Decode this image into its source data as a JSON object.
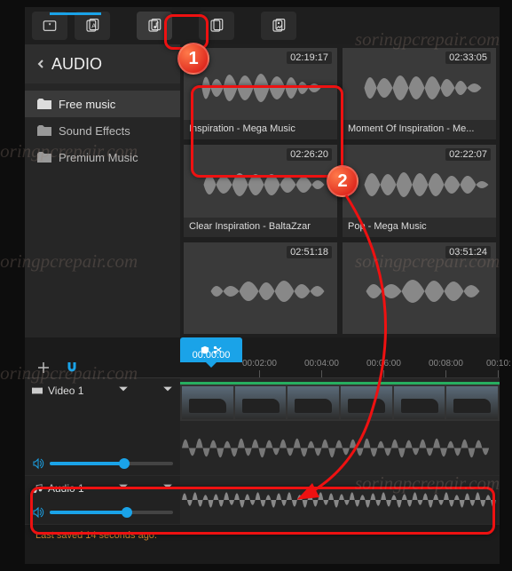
{
  "topbar": {
    "tabs": [
      "favorites",
      "text",
      "audio",
      "media",
      "image"
    ],
    "active_index": 2
  },
  "sidebar": {
    "title": "AUDIO",
    "categories": [
      {
        "label": "Free music",
        "selected": true
      },
      {
        "label": "Sound Effects",
        "selected": false
      },
      {
        "label": "Premium Music",
        "selected": false
      }
    ]
  },
  "clips": [
    {
      "duration": "02:19:17",
      "label": "Inspiration - Mega Music"
    },
    {
      "duration": "02:33:05",
      "label": "Moment Of Inspiration - Me..."
    },
    {
      "duration": "02:26:20",
      "label": "Clear Inspiration - BaltaZzar"
    },
    {
      "duration": "02:22:07",
      "label": "Pop - Mega Music"
    },
    {
      "duration": "02:51:18",
      "label": ""
    },
    {
      "duration": "03:51:24",
      "label": ""
    }
  ],
  "timeline": {
    "playhead": "00:00:00",
    "ticks": [
      "00:02:00",
      "00:04:00",
      "00:06:00",
      "00:08:00",
      "00:10:"
    ],
    "tracks": [
      {
        "type": "video",
        "name": "Video 1"
      },
      {
        "type": "audio",
        "name": "Audio 1"
      }
    ]
  },
  "status": "Last saved 14 seconds ago.",
  "annotations": {
    "step1": "1",
    "step2": "2"
  },
  "colors": {
    "accent": "#1aa3e8",
    "highlight": "#e11",
    "status": "#d6892f"
  },
  "watermark": "soringpcrepair.com"
}
